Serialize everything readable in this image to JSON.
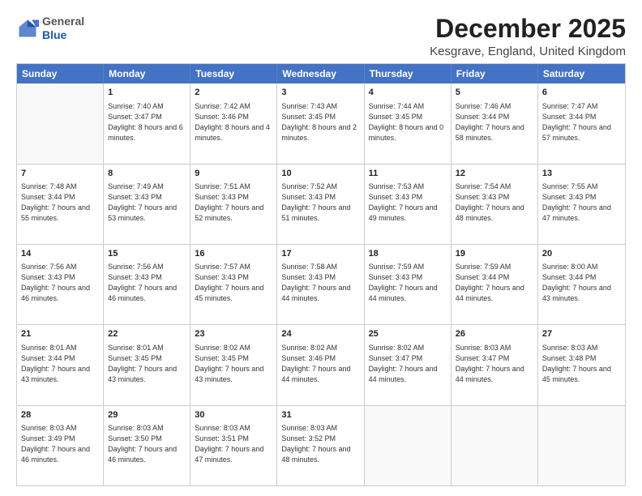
{
  "logo": {
    "general": "General",
    "blue": "Blue"
  },
  "header": {
    "title": "December 2025",
    "subtitle": "Kesgrave, England, United Kingdom"
  },
  "days_of_week": [
    "Sunday",
    "Monday",
    "Tuesday",
    "Wednesday",
    "Thursday",
    "Friday",
    "Saturday"
  ],
  "weeks": [
    [
      {
        "day": "",
        "empty": true
      },
      {
        "day": "1",
        "sunrise": "Sunrise: 7:40 AM",
        "sunset": "Sunset: 3:47 PM",
        "daylight": "Daylight: 8 hours and 6 minutes."
      },
      {
        "day": "2",
        "sunrise": "Sunrise: 7:42 AM",
        "sunset": "Sunset: 3:46 PM",
        "daylight": "Daylight: 8 hours and 4 minutes."
      },
      {
        "day": "3",
        "sunrise": "Sunrise: 7:43 AM",
        "sunset": "Sunset: 3:45 PM",
        "daylight": "Daylight: 8 hours and 2 minutes."
      },
      {
        "day": "4",
        "sunrise": "Sunrise: 7:44 AM",
        "sunset": "Sunset: 3:45 PM",
        "daylight": "Daylight: 8 hours and 0 minutes."
      },
      {
        "day": "5",
        "sunrise": "Sunrise: 7:46 AM",
        "sunset": "Sunset: 3:44 PM",
        "daylight": "Daylight: 7 hours and 58 minutes."
      },
      {
        "day": "6",
        "sunrise": "Sunrise: 7:47 AM",
        "sunset": "Sunset: 3:44 PM",
        "daylight": "Daylight: 7 hours and 57 minutes."
      }
    ],
    [
      {
        "day": "7",
        "sunrise": "Sunrise: 7:48 AM",
        "sunset": "Sunset: 3:44 PM",
        "daylight": "Daylight: 7 hours and 55 minutes."
      },
      {
        "day": "8",
        "sunrise": "Sunrise: 7:49 AM",
        "sunset": "Sunset: 3:43 PM",
        "daylight": "Daylight: 7 hours and 53 minutes."
      },
      {
        "day": "9",
        "sunrise": "Sunrise: 7:51 AM",
        "sunset": "Sunset: 3:43 PM",
        "daylight": "Daylight: 7 hours and 52 minutes."
      },
      {
        "day": "10",
        "sunrise": "Sunrise: 7:52 AM",
        "sunset": "Sunset: 3:43 PM",
        "daylight": "Daylight: 7 hours and 51 minutes."
      },
      {
        "day": "11",
        "sunrise": "Sunrise: 7:53 AM",
        "sunset": "Sunset: 3:43 PM",
        "daylight": "Daylight: 7 hours and 49 minutes."
      },
      {
        "day": "12",
        "sunrise": "Sunrise: 7:54 AM",
        "sunset": "Sunset: 3:43 PM",
        "daylight": "Daylight: 7 hours and 48 minutes."
      },
      {
        "day": "13",
        "sunrise": "Sunrise: 7:55 AM",
        "sunset": "Sunset: 3:43 PM",
        "daylight": "Daylight: 7 hours and 47 minutes."
      }
    ],
    [
      {
        "day": "14",
        "sunrise": "Sunrise: 7:56 AM",
        "sunset": "Sunset: 3:43 PM",
        "daylight": "Daylight: 7 hours and 46 minutes."
      },
      {
        "day": "15",
        "sunrise": "Sunrise: 7:56 AM",
        "sunset": "Sunset: 3:43 PM",
        "daylight": "Daylight: 7 hours and 46 minutes."
      },
      {
        "day": "16",
        "sunrise": "Sunrise: 7:57 AM",
        "sunset": "Sunset: 3:43 PM",
        "daylight": "Daylight: 7 hours and 45 minutes."
      },
      {
        "day": "17",
        "sunrise": "Sunrise: 7:58 AM",
        "sunset": "Sunset: 3:43 PM",
        "daylight": "Daylight: 7 hours and 44 minutes."
      },
      {
        "day": "18",
        "sunrise": "Sunrise: 7:59 AM",
        "sunset": "Sunset: 3:43 PM",
        "daylight": "Daylight: 7 hours and 44 minutes."
      },
      {
        "day": "19",
        "sunrise": "Sunrise: 7:59 AM",
        "sunset": "Sunset: 3:44 PM",
        "daylight": "Daylight: 7 hours and 44 minutes."
      },
      {
        "day": "20",
        "sunrise": "Sunrise: 8:00 AM",
        "sunset": "Sunset: 3:44 PM",
        "daylight": "Daylight: 7 hours and 43 minutes."
      }
    ],
    [
      {
        "day": "21",
        "sunrise": "Sunrise: 8:01 AM",
        "sunset": "Sunset: 3:44 PM",
        "daylight": "Daylight: 7 hours and 43 minutes."
      },
      {
        "day": "22",
        "sunrise": "Sunrise: 8:01 AM",
        "sunset": "Sunset: 3:45 PM",
        "daylight": "Daylight: 7 hours and 43 minutes."
      },
      {
        "day": "23",
        "sunrise": "Sunrise: 8:02 AM",
        "sunset": "Sunset: 3:45 PM",
        "daylight": "Daylight: 7 hours and 43 minutes."
      },
      {
        "day": "24",
        "sunrise": "Sunrise: 8:02 AM",
        "sunset": "Sunset: 3:46 PM",
        "daylight": "Daylight: 7 hours and 44 minutes."
      },
      {
        "day": "25",
        "sunrise": "Sunrise: 8:02 AM",
        "sunset": "Sunset: 3:47 PM",
        "daylight": "Daylight: 7 hours and 44 minutes."
      },
      {
        "day": "26",
        "sunrise": "Sunrise: 8:03 AM",
        "sunset": "Sunset: 3:47 PM",
        "daylight": "Daylight: 7 hours and 44 minutes."
      },
      {
        "day": "27",
        "sunrise": "Sunrise: 8:03 AM",
        "sunset": "Sunset: 3:48 PM",
        "daylight": "Daylight: 7 hours and 45 minutes."
      }
    ],
    [
      {
        "day": "28",
        "sunrise": "Sunrise: 8:03 AM",
        "sunset": "Sunset: 3:49 PM",
        "daylight": "Daylight: 7 hours and 46 minutes."
      },
      {
        "day": "29",
        "sunrise": "Sunrise: 8:03 AM",
        "sunset": "Sunset: 3:50 PM",
        "daylight": "Daylight: 7 hours and 46 minutes."
      },
      {
        "day": "30",
        "sunrise": "Sunrise: 8:03 AM",
        "sunset": "Sunset: 3:51 PM",
        "daylight": "Daylight: 7 hours and 47 minutes."
      },
      {
        "day": "31",
        "sunrise": "Sunrise: 8:03 AM",
        "sunset": "Sunset: 3:52 PM",
        "daylight": "Daylight: 7 hours and 48 minutes."
      },
      {
        "day": "",
        "empty": true
      },
      {
        "day": "",
        "empty": true
      },
      {
        "day": "",
        "empty": true
      }
    ]
  ]
}
